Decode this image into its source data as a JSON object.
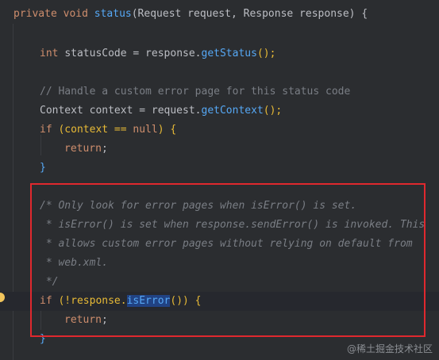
{
  "code": {
    "line1": {
      "kw": "private",
      "type": "void",
      "name": "status",
      "params": "(Request request, Response response)",
      "brace": "{"
    },
    "line2": {
      "type": "int",
      "rest": "statusCode = response.",
      "call": "getStatus",
      "end": "();"
    },
    "line3": {
      "comment": "// Handle a custom error page for this status code"
    },
    "line4": {
      "text": "Context context = request.",
      "call": "getContext",
      "end": "();"
    },
    "line5": {
      "kw": "if",
      "open": "(context == ",
      "null": "null",
      "close": ") {"
    },
    "line6": {
      "kw": "return",
      "end": ";"
    },
    "line7": {
      "brace": "}"
    },
    "line8": {
      "comment": "/* Only look for error pages when isError() is set."
    },
    "line9": {
      "comment": " * isError() is set when response.sendError() is invoked. This"
    },
    "line10": {
      "comment": " * allows custom error pages without relying on default from"
    },
    "line11": {
      "comment": " * web.xml."
    },
    "line12": {
      "comment": " */"
    },
    "line13": {
      "kw": "if",
      "open": "(!response.",
      "call": "isError",
      "close": "()) {"
    },
    "line14": {
      "kw": "return",
      "end": ";"
    },
    "line15": {
      "brace": "}"
    }
  },
  "watermark": "@稀土掘金技术社区",
  "colors": {
    "background": "#2b2d30",
    "highlight_box": "#e0282e",
    "keyword": "#cf8e6d",
    "method": "#56a8f5",
    "comment": "#7a7e85"
  }
}
